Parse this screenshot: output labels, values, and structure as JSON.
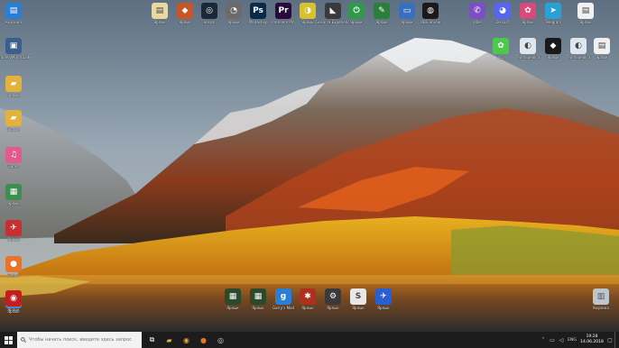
{
  "desktop": {
    "left_column": [
      {
        "label": "Корзина",
        "icon": "folder-icon",
        "glyph": "▤",
        "color": "#2a7fd4"
      },
      {
        "label": "Oracle VM VirtualBox",
        "icon": "virtualbox-icon",
        "glyph": "▣",
        "color": "#3a5f8f"
      },
      {
        "label": "Ярлык",
        "icon": "folder-icon",
        "glyph": "▰",
        "color": "#e3b23c"
      },
      {
        "label": "Ярлык",
        "icon": "folder-icon",
        "glyph": "▰",
        "color": "#e3b23c"
      },
      {
        "label": "iTunes",
        "icon": "itunes-icon",
        "glyph": "♫",
        "color": "#e25a8e"
      },
      {
        "label": "Ярлык",
        "icon": "app-icon",
        "glyph": "▦",
        "color": "#3d8f4f"
      },
      {
        "label": "Ярлык",
        "icon": "app-icon",
        "glyph": "✈",
        "color": "#c73030"
      },
      {
        "label": "Firefox",
        "icon": "firefox-icon",
        "glyph": "●",
        "color": "#e8732a"
      },
      {
        "label": "Ярлык",
        "icon": "app-icon",
        "glyph": "▦",
        "color": "#3a8fd6"
      },
      {
        "label": "Ярлык",
        "icon": "app-icon",
        "glyph": "◉",
        "color": "#c41d1d"
      }
    ],
    "top_row": [
      {
        "label": "Ярлык",
        "icon": "document-icon",
        "glyph": "▤",
        "color": "#e9d9a0"
      },
      {
        "label": "Ярлык",
        "icon": "app-icon",
        "glyph": "◆",
        "color": "#c7542a"
      },
      {
        "label": "Steam",
        "icon": "steam-icon",
        "glyph": "◎",
        "color": "#1b2838"
      },
      {
        "label": "Ярлык",
        "icon": "app-icon",
        "glyph": "◔",
        "color": "#6b6b6b"
      },
      {
        "label": "Photoshop",
        "icon": "photoshop-icon",
        "glyph": "Ps",
        "color": "#0a2a4a"
      },
      {
        "label": "Premiere Pro",
        "icon": "premiere-icon",
        "glyph": "Pr",
        "color": "#2a0a3a"
      },
      {
        "label": "Ярлык",
        "icon": "app-icon",
        "glyph": "◑",
        "color": "#d9c030"
      },
      {
        "label": "GeForce Experience",
        "icon": "geforce-icon",
        "glyph": "◣",
        "color": "#3a3a3a"
      },
      {
        "label": "Ярлык",
        "icon": "app-icon",
        "glyph": "⏻",
        "color": "#2f9a4a"
      },
      {
        "label": "Ярлык",
        "icon": "app-icon",
        "glyph": "✎",
        "color": "#2a7f3a"
      },
      {
        "label": "Ярлык",
        "icon": "computer-icon",
        "glyph": "▭",
        "color": "#3a6fbf"
      },
      {
        "label": "OBS Studio",
        "icon": "obs-icon",
        "glyph": "◍",
        "color": "#1a1a1a"
      }
    ],
    "right_block": [
      {
        "label": "Viber",
        "icon": "viber-icon",
        "glyph": "✆",
        "color": "#7d4fc4"
      },
      {
        "label": "Discord",
        "icon": "discord-icon",
        "glyph": "◕",
        "color": "#5865f2"
      },
      {
        "label": "Ярлык",
        "icon": "app-icon",
        "glyph": "✿",
        "color": "#d84a7a"
      },
      {
        "label": "Telegram",
        "icon": "telegram-icon",
        "glyph": "➤",
        "color": "#2aa0d8"
      },
      {
        "label": "Ярлык",
        "icon": "document-icon",
        "glyph": "▤",
        "color": "#f0f0f0"
      },
      {
        "label": "ICQ",
        "icon": "icq-icon",
        "glyph": "✿",
        "color": "#4cc84c"
      },
      {
        "label": "TeamSpeak 3",
        "icon": "teamspeak-icon",
        "glyph": "◐",
        "color": "#e0e6ee"
      },
      {
        "label": "Ярлык",
        "icon": "app-icon",
        "glyph": "◆",
        "color": "#1a1a1a"
      },
      {
        "label": "TeamSpeak 3",
        "icon": "teamspeak-icon",
        "glyph": "◐",
        "color": "#e0e6ee"
      },
      {
        "label": "Ярлык",
        "icon": "document-icon",
        "glyph": "▤",
        "color": "#f0f0f0"
      }
    ],
    "bottom_row": [
      {
        "label": "Ярлык",
        "icon": "app-icon",
        "glyph": "▦",
        "color": "#2a4a2a"
      },
      {
        "label": "Ярлык",
        "icon": "app-icon",
        "glyph": "▦",
        "color": "#2a4a2a"
      },
      {
        "label": "Garry's Mod",
        "icon": "garrysmod-icon",
        "glyph": "g",
        "color": "#2a7fd4"
      },
      {
        "label": "Ярлык",
        "icon": "app-icon",
        "glyph": "✱",
        "color": "#b03020"
      },
      {
        "label": "Ярлык",
        "icon": "app-icon",
        "glyph": "⚙",
        "color": "#3a3a3a"
      },
      {
        "label": "Ярлык",
        "icon": "app-icon",
        "glyph": "S",
        "color": "#e8e8e8"
      },
      {
        "label": "Ярлык",
        "icon": "app-icon",
        "glyph": "✈",
        "color": "#2a5fd4"
      }
    ],
    "recycle_bin": {
      "label": "Корзина",
      "icon": "recycle-bin-icon",
      "glyph": "🗑",
      "color": "#bcc6cc"
    }
  },
  "taskbar": {
    "start_icon": "windows-start-icon",
    "search_placeholder": "Чтобы начать поиск, введите здесь запрос",
    "apps": [
      {
        "icon": "task-view-icon",
        "glyph": "⧉",
        "color": "#ffffff"
      },
      {
        "icon": "file-explorer-icon",
        "glyph": "▰",
        "color": "#e8b84a"
      },
      {
        "icon": "chrome-icon",
        "glyph": "◉",
        "color": "#e8a23a"
      },
      {
        "icon": "firefox-icon",
        "glyph": "●",
        "color": "#e8732a"
      },
      {
        "icon": "steam-icon",
        "glyph": "◎",
        "color": "#c9d4dc"
      }
    ],
    "tray": {
      "language": "ENG",
      "time": "19:28",
      "date": "14.06.2018"
    }
  }
}
